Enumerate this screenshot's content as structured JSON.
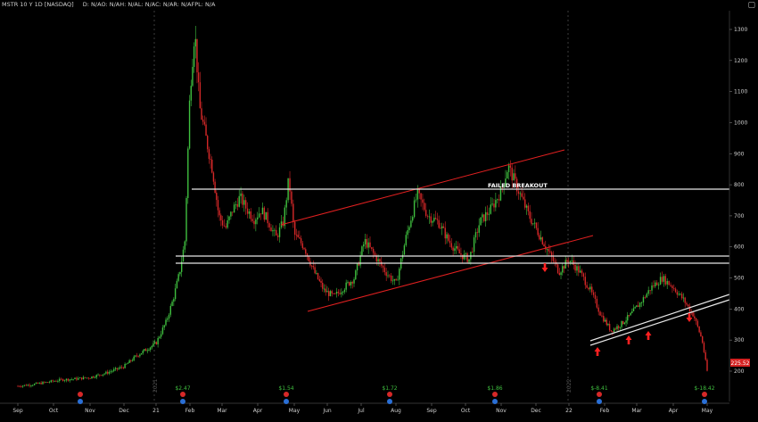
{
  "header": {
    "symbol": "MSTR 10 Y 1D [NASDAQ]",
    "indicators": "D: N/AO: N/AH: N/AL: N/AC: N/AR: N/AFPL: N/A"
  },
  "colors": {
    "background": "#000000",
    "up": "#3fbf3f",
    "down": "#d62828",
    "trendline": "#e02020",
    "level": "#e6e6e6",
    "price_tag": "#d42020"
  },
  "chart_data": {
    "type": "candlestick",
    "ylim": [
      175,
      1340
    ],
    "y_ticks": [
      1300,
      1200,
      1100,
      1000,
      900,
      800,
      700,
      600,
      500,
      400,
      300,
      200
    ],
    "x_ticks": [
      "Sep",
      "Oct",
      "Nov",
      "Dec",
      "21",
      "Feb",
      "Mar",
      "Apr",
      "May",
      "Jun",
      "Jul",
      "Aug",
      "Sep",
      "Oct",
      "Nov",
      "Dec",
      "22",
      "Feb",
      "Mar",
      "Apr",
      "May"
    ],
    "year_markers": [
      "2021",
      "2022"
    ],
    "last_price": "225.52",
    "annotation": "FAILED BREAKOUT",
    "dividends": [
      "$2.47",
      "$1.54",
      "$1.72",
      "$1.86",
      "$-8.41",
      "$-18.42"
    ],
    "price_path": [
      [
        0,
        152
      ],
      [
        0.4,
        157
      ],
      [
        0.8,
        164
      ],
      [
        1.2,
        172
      ],
      [
        1.6,
        175
      ],
      [
        2.0,
        180
      ],
      [
        2.5,
        195
      ],
      [
        3.0,
        215
      ],
      [
        3.4,
        250
      ],
      [
        3.7,
        270
      ],
      [
        4.0,
        290
      ],
      [
        4.3,
        360
      ],
      [
        4.5,
        430
      ],
      [
        4.7,
        520
      ],
      [
        4.85,
        620
      ],
      [
        5.0,
        1100
      ],
      [
        5.15,
        1300
      ],
      [
        5.3,
        1050
      ],
      [
        5.5,
        950
      ],
      [
        5.7,
        850
      ],
      [
        5.9,
        700
      ],
      [
        6.1,
        660
      ],
      [
        6.3,
        720
      ],
      [
        6.5,
        760
      ],
      [
        6.7,
        720
      ],
      [
        6.9,
        690
      ],
      [
        7.1,
        720
      ],
      [
        7.3,
        680
      ],
      [
        7.5,
        630
      ],
      [
        7.7,
        680
      ],
      [
        7.85,
        820
      ],
      [
        8.0,
        640
      ],
      [
        8.3,
        600
      ],
      [
        8.6,
        520
      ],
      [
        8.9,
        460
      ],
      [
        9.2,
        440
      ],
      [
        9.5,
        470
      ],
      [
        9.8,
        500
      ],
      [
        10.1,
        620
      ],
      [
        10.4,
        570
      ],
      [
        10.7,
        520
      ],
      [
        11.0,
        480
      ],
      [
        11.3,
        640
      ],
      [
        11.6,
        770
      ],
      [
        11.9,
        700
      ],
      [
        12.2,
        680
      ],
      [
        12.5,
        620
      ],
      [
        12.8,
        580
      ],
      [
        13.1,
        560
      ],
      [
        13.4,
        680
      ],
      [
        13.7,
        720
      ],
      [
        14.0,
        780
      ],
      [
        14.2,
        860
      ],
      [
        14.5,
        780
      ],
      [
        14.8,
        700
      ],
      [
        15.1,
        640
      ],
      [
        15.4,
        580
      ],
      [
        15.7,
        520
      ],
      [
        16.0,
        560
      ],
      [
        16.3,
        520
      ],
      [
        16.6,
        460
      ],
      [
        16.9,
        380
      ],
      [
        17.2,
        330
      ],
      [
        17.5,
        350
      ],
      [
        17.8,
        380
      ],
      [
        18.1,
        420
      ],
      [
        18.4,
        470
      ],
      [
        18.7,
        500
      ],
      [
        19.0,
        470
      ],
      [
        19.3,
        430
      ],
      [
        19.6,
        380
      ],
      [
        19.85,
        300
      ],
      [
        20.0,
        200
      ]
    ]
  }
}
